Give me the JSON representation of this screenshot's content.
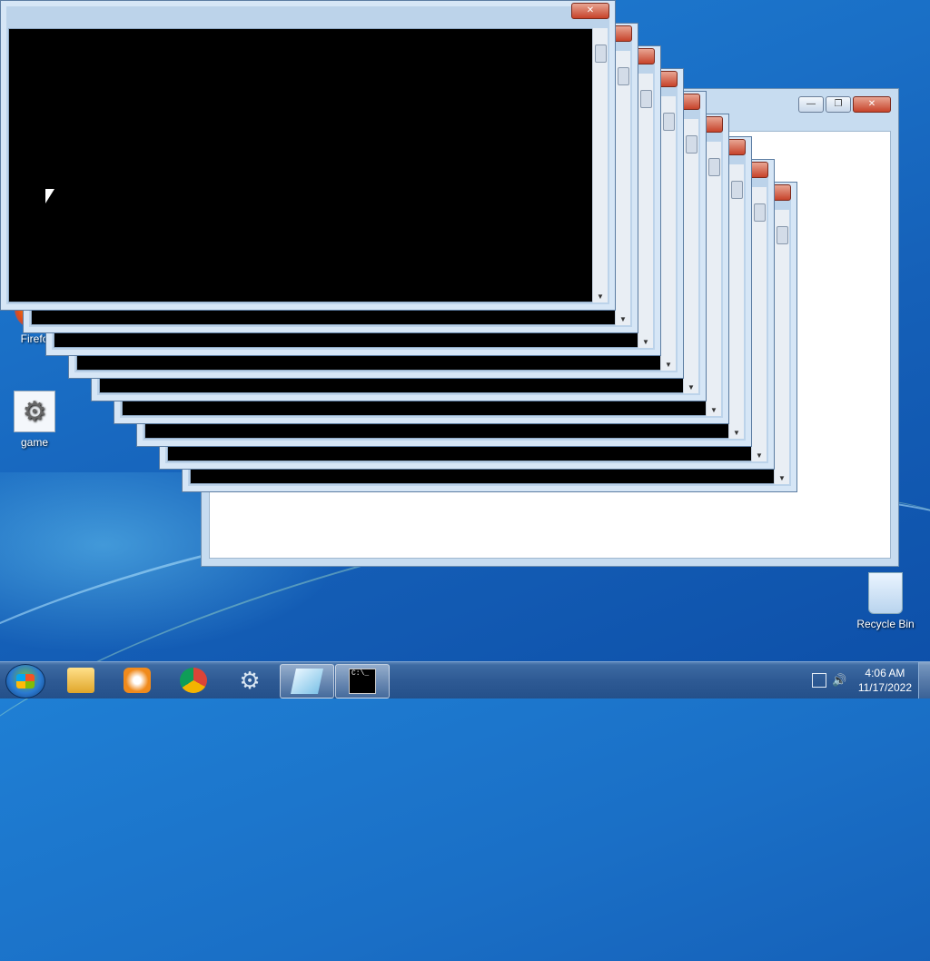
{
  "desktop": {
    "icons": [
      {
        "label": "Firefo"
      },
      {
        "label": "game"
      },
      {
        "label": "Recycle Bin"
      }
    ]
  },
  "windows": {
    "console_count": 8,
    "caption": {
      "minimize": "—",
      "maximize": "❐",
      "close": "✕"
    }
  },
  "taskbar": {
    "items": [
      {
        "name": "start"
      },
      {
        "name": "windows-explorer"
      },
      {
        "name": "windows-media-player"
      },
      {
        "name": "google-chrome"
      },
      {
        "name": "game-app"
      },
      {
        "name": "notepad",
        "active": true
      },
      {
        "name": "command-prompt",
        "active": true,
        "label": "C:\\_"
      }
    ],
    "clock": {
      "time": "4:06 AM",
      "date": "11/17/2022"
    }
  }
}
